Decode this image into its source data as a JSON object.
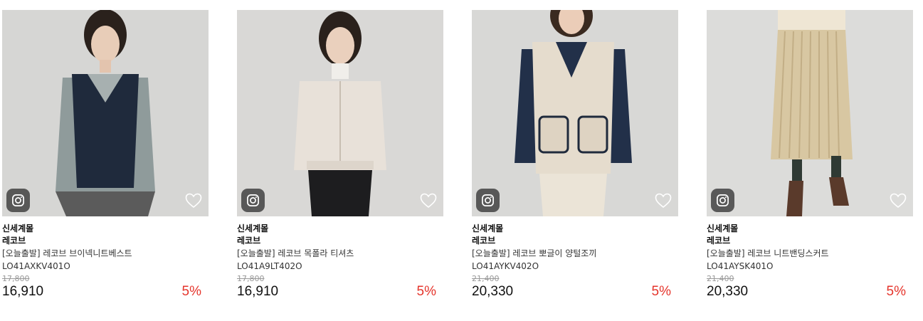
{
  "products": [
    {
      "mall": "신세계몰",
      "brand": "레코브",
      "name": "[오늘출발] 레코브 브이넥니트베스트",
      "code": "LO41AXKV401O",
      "original_price": "17,800",
      "price": "16,910",
      "discount": "5%"
    },
    {
      "mall": "신세계몰",
      "brand": "레코브",
      "name": "[오늘출발] 레코브 목폴라 티셔츠",
      "code": "LO41A9LT402O",
      "original_price": "17,800",
      "price": "16,910",
      "discount": "5%"
    },
    {
      "mall": "신세계몰",
      "brand": "레코브",
      "name": "[오늘출발] 레코브 뽀글이 양털조끼",
      "code": "LO41AYKV402O",
      "original_price": "21,400",
      "price": "20,330",
      "discount": "5%"
    },
    {
      "mall": "신세계몰",
      "brand": "레코브",
      "name": "[오늘출발] 레코브 니트밴딩스커트",
      "code": "LO41AYSK401O",
      "original_price": "21,400",
      "price": "20,330",
      "discount": "5%"
    }
  ],
  "icons": {
    "badge": "instagram-icon",
    "wishlist": "heart-outline-icon"
  },
  "colors": {
    "discount": "#e5352c",
    "strike_price": "#999999",
    "badge_bg": "#3c3c3c"
  }
}
